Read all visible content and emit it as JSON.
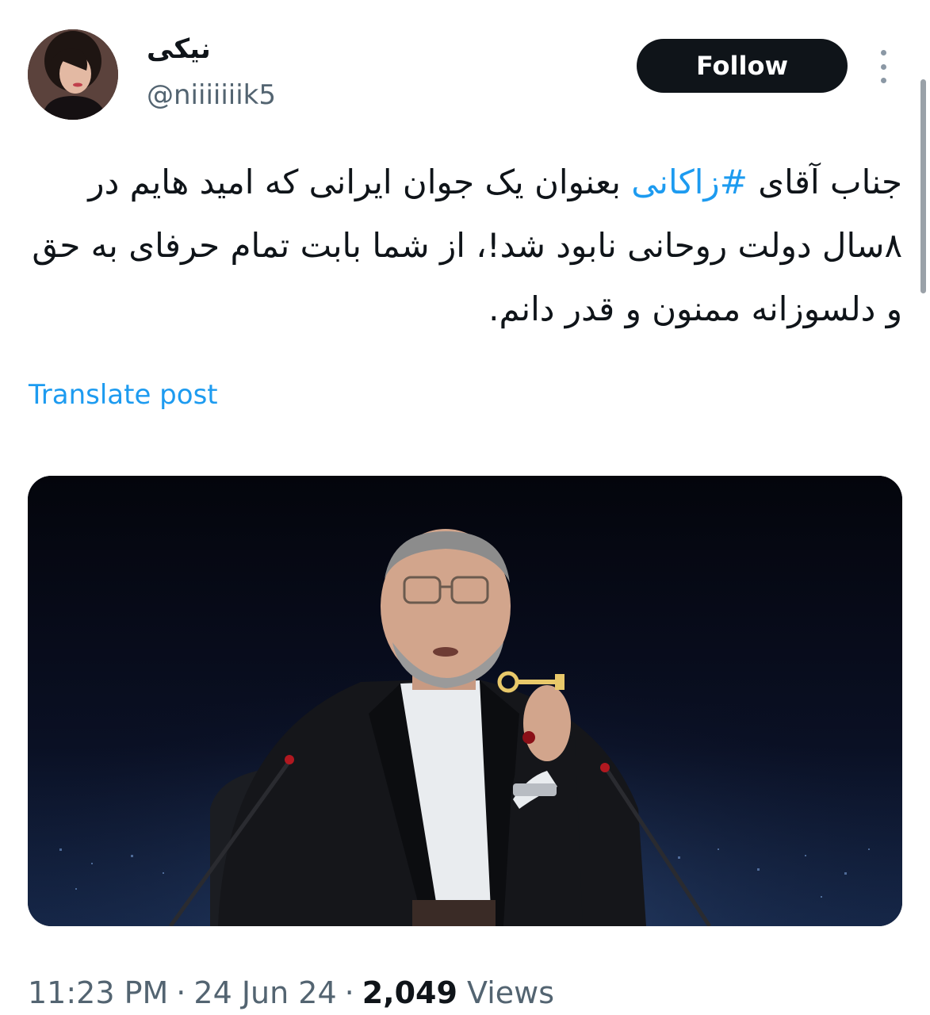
{
  "user": {
    "display_name": "نیکی",
    "handle": "@niiiiiiik5",
    "avatar_icon": "profile-photo"
  },
  "actions": {
    "follow_label": "Follow",
    "more_icon": "more-vertical-icon"
  },
  "tweet": {
    "text_before_hashtag": "جناب آقای ",
    "hashtag": "#زاکانی",
    "text_after_hashtag": " بعنوان یک جوان ایرانی که امید هایم در ۸سال دولت روحانی نابود شد!، از شما بابت تمام حرفای به حق و دلسوزانه ممنون و قدر دانم.",
    "translate_label": "Translate post"
  },
  "meta": {
    "time": "11:23 PM",
    "separator": "·",
    "date": "24 Jun 24",
    "views_count": "2,049",
    "views_label": "Views"
  },
  "colors": {
    "link": "#1d9bf0",
    "follow_bg": "#0f1419",
    "secondary_text": "#536471"
  }
}
